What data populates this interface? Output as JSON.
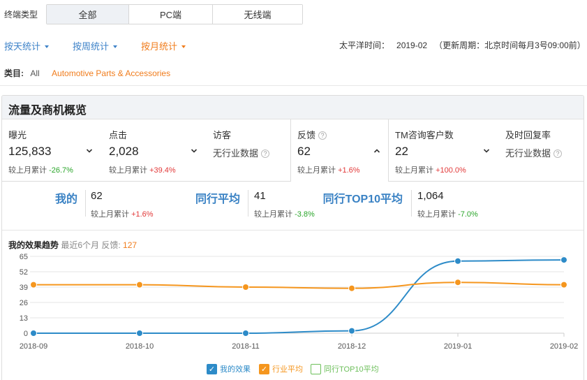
{
  "terminal": {
    "label": "终端类型",
    "options": [
      "全部",
      "PC端",
      "无线端"
    ],
    "selected": "全部"
  },
  "period_tabs": [
    {
      "label": "按天统计",
      "active": false
    },
    {
      "label": "按周统计",
      "active": false
    },
    {
      "label": "按月统计",
      "active": true
    }
  ],
  "timezone": {
    "label": "太平洋时间：",
    "value": "2019-02",
    "note": "（更新周期：北京时间每月3号09:00前）"
  },
  "category": {
    "label": "类目:",
    "all": "All",
    "current": "Automotive Parts & Accessories"
  },
  "overview": {
    "title": "流量及商机概览",
    "metrics": [
      {
        "name": "曝光",
        "value": "125,833",
        "cmp_label": "较上月累计",
        "cmp_value": "-26.7%",
        "trend": "down",
        "toggle": "chevron-down-icon"
      },
      {
        "name": "点击",
        "value": "2,028",
        "cmp_label": "较上月累计",
        "cmp_value": "+39.4%",
        "trend": "up",
        "toggle": "chevron-down-icon"
      },
      {
        "name": "访客",
        "value": "无行业数据",
        "help": "?"
      },
      {
        "name": "反馈",
        "value": "62",
        "cmp_label": "较上月累计",
        "cmp_value": "+1.6%",
        "trend": "up",
        "toggle": "chevron-up-icon",
        "selected": true,
        "help": "?"
      },
      {
        "name": "TM咨询客户数",
        "value": "22",
        "cmp_label": "较上月累计",
        "cmp_value": "+100.0%",
        "trend": "up",
        "toggle": "chevron-down-icon"
      },
      {
        "name": "及时回复率",
        "value": "无行业数据",
        "help": "?"
      }
    ],
    "comparison": [
      {
        "label": "我的",
        "value": "62",
        "cmp_label": "较上月累计",
        "cmp_value": "+1.6%",
        "trend": "up"
      },
      {
        "label": "同行平均",
        "value": "41",
        "cmp_label": "较上月累计",
        "cmp_value": "-3.8%",
        "trend": "down"
      },
      {
        "label": "同行TOP10平均",
        "value": "1,064",
        "cmp_label": "较上月累计",
        "cmp_value": "-7.0%",
        "trend": "down"
      }
    ],
    "trend": {
      "title": "我的效果趋势",
      "subtitle": "最近6个月 反馈:",
      "count": "127"
    }
  },
  "colors": {
    "blue": "#2d8bc8",
    "orange": "#f5961e",
    "green": "#6cbf5a",
    "up": "#e23a3a",
    "down": "#2aa52a"
  },
  "chart_data": {
    "type": "line",
    "categories": [
      "2018-09",
      "2018-10",
      "2018-11",
      "2018-12",
      "2019-01",
      "2019-02"
    ],
    "yticks": [
      0,
      13,
      26,
      39,
      52,
      65
    ],
    "ylim": [
      0,
      65
    ],
    "grid": true,
    "legend_position": "bottom",
    "series": [
      {
        "name": "我的效果",
        "values": [
          0,
          0,
          0,
          2,
          61,
          62
        ],
        "color": "#2d8bc8",
        "checked": true
      },
      {
        "name": "行业平均",
        "values": [
          41,
          41,
          39,
          38,
          43,
          41
        ],
        "color": "#f5961e",
        "checked": true
      },
      {
        "name": "同行TOP10平均",
        "values": [],
        "color": "#6cbf5a",
        "checked": false
      }
    ]
  }
}
